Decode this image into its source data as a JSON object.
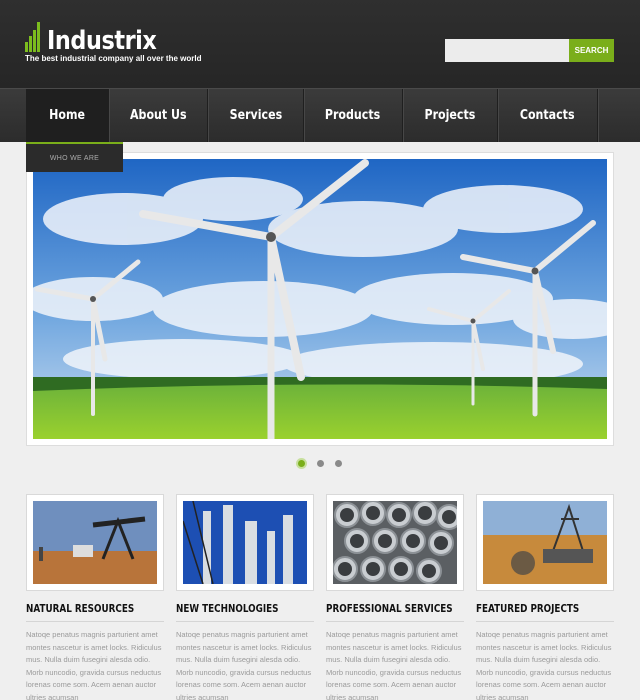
{
  "brand": {
    "name": "Industrix",
    "tagline": "The best industrial company all over the world",
    "accent_color": "#7aae1a"
  },
  "search": {
    "placeholder": "",
    "button_label": "SEARCH"
  },
  "nav": {
    "items": [
      {
        "label": "Home",
        "active": true
      },
      {
        "label": "About Us"
      },
      {
        "label": "Services"
      },
      {
        "label": "Products"
      },
      {
        "label": "Projects"
      },
      {
        "label": "Contacts"
      }
    ],
    "submenu_label": "WHO WE ARE"
  },
  "slider": {
    "image": "wind-turbines-photo",
    "dots_count": 3,
    "active_dot": 1
  },
  "features": [
    {
      "image": "oil-pump-photo",
      "title": "NATURAL RESOURCES",
      "text": "Natoqe penatus magnis parturient amet montes nascetur is amet locks. Ridiculus mus. Nulla duim fusegini alesda odio. Morb nuncodio, gravida cursus neductus lorenas come som. Acem aenan auctor ultries acumsan"
    },
    {
      "image": "refinery-photo",
      "title": "NEW TECHNOLOGIES",
      "text": "Natoqe penatus magnis parturient amet montes nascetur is amet locks. Ridiculus mus. Nulla duim fusegini alesda odio. Morb nuncodio, gravida cursus neductus lorenas come som. Acem aenan auctor ultries acumsan"
    },
    {
      "image": "steel-pipes-photo",
      "title": "PROFESSIONAL SERVICES",
      "text": "Natoqe penatus magnis parturient amet montes nascetur is amet locks. Ridiculus mus. Nulla duim fusegini alesda odio. Morb nuncodio, gravida cursus neductus lorenas come som. Acem aenan auctor ultries acumsan"
    },
    {
      "image": "mining-excavator-photo",
      "title": "FEATURED PROJECTS",
      "text": "Natoqe penatus magnis parturient amet montes nascetur is amet locks. Ridiculus mus. Nulla duim fusegini alesda odio. Morb nuncodio, gravida cursus neductus lorenas come som. Acem aenan auctor ultries acumsan"
    }
  ]
}
